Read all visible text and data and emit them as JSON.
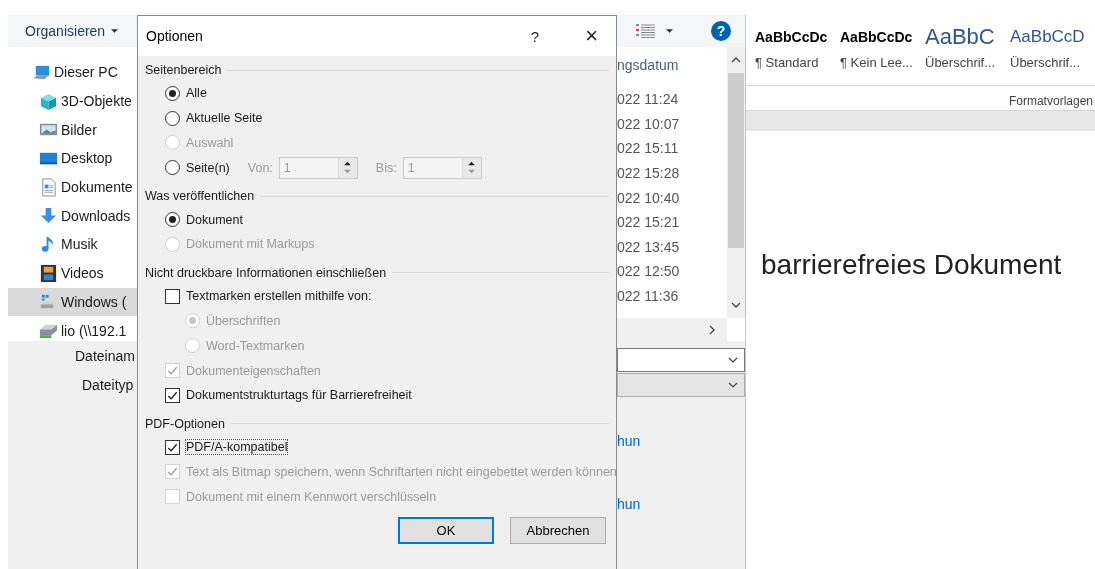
{
  "word": {
    "styles": [
      {
        "kind": "normal",
        "sample": "AaBbCcDc",
        "label": "¶ Standard"
      },
      {
        "kind": "normal",
        "sample": "AaBbCcDc",
        "label": "¶ Kein Lee..."
      },
      {
        "kind": "heading1",
        "sample": "AaBbC",
        "label": "Überschrif..."
      },
      {
        "kind": "heading2",
        "sample": "AaBbCcD",
        "label": "Überschrif..."
      }
    ],
    "group_label": "Formatvorlagen",
    "document_text": "barrierefreies Dokument"
  },
  "save_dialog": {
    "organize": "Organisieren",
    "help": "?",
    "nav": [
      {
        "label": "Dieser PC",
        "kind": "pc",
        "selected": false,
        "children": [
          {
            "label": "3D-Objekte",
            "kind": "cube",
            "selected": false
          },
          {
            "label": "Bilder",
            "kind": "image",
            "selected": false
          },
          {
            "label": "Desktop",
            "kind": "desktop",
            "selected": false
          },
          {
            "label": "Dokumente",
            "kind": "document",
            "selected": false
          },
          {
            "label": "Downloads",
            "kind": "download",
            "selected": false
          },
          {
            "label": "Musik",
            "kind": "music",
            "selected": false
          },
          {
            "label": "Videos",
            "kind": "video",
            "selected": false
          },
          {
            "label": "Windows (",
            "kind": "drive",
            "selected": true
          },
          {
            "label": "lio (\\\\192.1",
            "kind": "network",
            "selected": false
          }
        ]
      }
    ],
    "column_header": "ngsdatum",
    "dates": [
      "022 11:24",
      "022 10:07",
      "022 15:11",
      "022 15:28",
      "022 10:40",
      "022 15:21",
      "022 13:45",
      "022 12:50",
      "022 11:36"
    ],
    "filename_label": "Dateinam",
    "filetype_label": "Dateityp",
    "links": [
      "hun",
      "hun"
    ]
  },
  "options_dialog": {
    "title": "Optionen",
    "help": "?",
    "close": "×",
    "sections": [
      {
        "heading": "Seitenbereich",
        "items": [
          {
            "kind": "radio",
            "label": "Alle",
            "selected": true,
            "disabled": false
          },
          {
            "kind": "radio",
            "label": "Aktuelle Seite",
            "selected": false,
            "disabled": false
          },
          {
            "kind": "radio",
            "label": "Auswahl",
            "selected": false,
            "disabled": true
          },
          {
            "kind": "range",
            "label": "Seite(n)",
            "selected": false,
            "disabled": false,
            "from_label": "Von:",
            "from_value": "1",
            "to_label": "Bis:",
            "to_value": "1"
          }
        ]
      },
      {
        "heading": "Was veröffentlichen",
        "items": [
          {
            "kind": "radio",
            "label": "Dokument",
            "selected": true,
            "disabled": false
          },
          {
            "kind": "radio",
            "label": "Dokument mit Markups",
            "selected": false,
            "disabled": true
          }
        ]
      },
      {
        "heading": "Nicht druckbare Informationen einschließen",
        "items": [
          {
            "kind": "checkbox",
            "label": "Textmarken erstellen mithilfe von:",
            "checked": false,
            "disabled": false,
            "children": [
              {
                "kind": "radio",
                "label": "Überschriften",
                "selected": true,
                "disabled": true
              },
              {
                "kind": "radio",
                "label": "Word-Textmarken",
                "selected": false,
                "disabled": true
              }
            ]
          },
          {
            "kind": "checkbox",
            "label": "Dokumenteigenschaften",
            "checked": true,
            "disabled": true
          },
          {
            "kind": "checkbox",
            "label": "Dokumentstrukturtags für Barrierefreiheit",
            "checked": true,
            "disabled": false
          }
        ]
      },
      {
        "heading": "PDF-Optionen",
        "items": [
          {
            "kind": "checkbox",
            "label": "PDF/A-kompatibel",
            "checked": true,
            "disabled": false,
            "focused": true
          },
          {
            "kind": "checkbox",
            "label": "Text als Bitmap speichern, wenn Schriftarten nicht eingebettet werden können",
            "checked": true,
            "disabled": true
          },
          {
            "kind": "checkbox",
            "label": "Dokument mit einem Kennwort verschlüsseln",
            "checked": false,
            "disabled": true
          }
        ]
      }
    ],
    "buttons": [
      {
        "label": "OK",
        "default": true
      },
      {
        "label": "Abbrechen",
        "default": false
      }
    ]
  }
}
